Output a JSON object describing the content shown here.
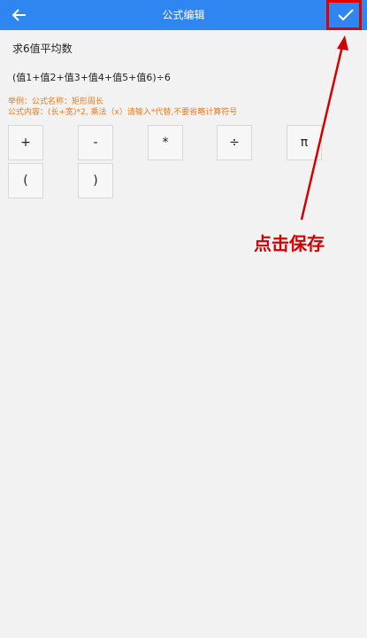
{
  "header": {
    "title": "公式编辑"
  },
  "formula": {
    "name": "求6值平均数",
    "content": "(值1+值2+值3+值4+值5+值6)÷6"
  },
  "hints": {
    "line1": "举例：公式名称：矩形周长",
    "line2": "公式内容：(长+宽)*2, 乘法（x）请输入*代替,不要省略计算符号"
  },
  "keys": {
    "plus": "+",
    "minus": "-",
    "multiply": "*",
    "divide": "÷",
    "pi": "π",
    "lparen": "(",
    "rparen": ")"
  },
  "annotation": {
    "text": "点击保存"
  },
  "colors": {
    "header_bg": "#2f86f0",
    "hint": "#f07a1a",
    "annotation": "#d40000"
  },
  "icons": {
    "back": "back-arrow-icon",
    "save": "checkmark-icon"
  }
}
